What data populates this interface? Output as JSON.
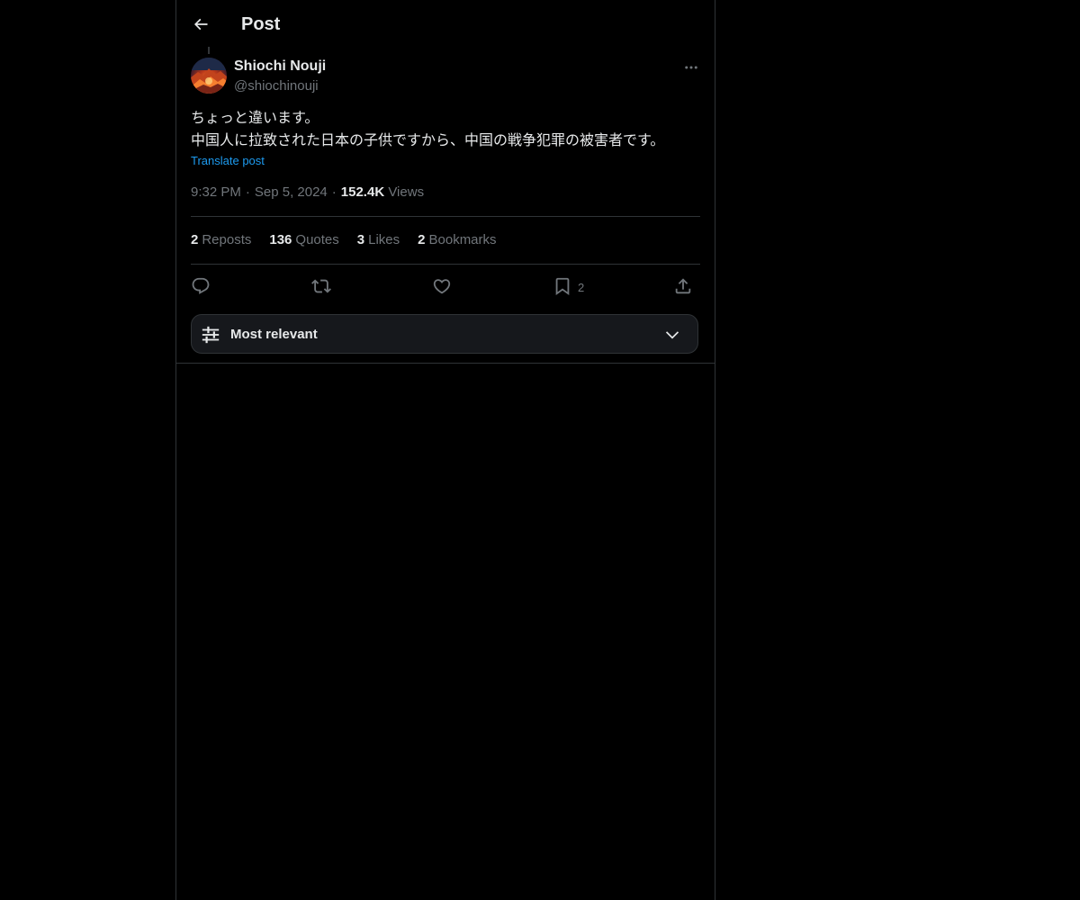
{
  "header": {
    "title": "Post",
    "back_icon": "arrow-left-icon"
  },
  "post": {
    "author": {
      "display_name": "Shiochi Nouji",
      "handle": "@shiochinouji"
    },
    "text_lines": [
      "ちょっと違います。",
      "中国人に拉致された日本の子供ですから、中国の戦争犯罪の被害者です。"
    ],
    "translate_label": "Translate post",
    "time": "9:32 PM",
    "date": "Sep 5, 2024",
    "views_count": "152.4K",
    "views_label": "Views",
    "separator": "·"
  },
  "stats": [
    {
      "count": "2",
      "label": "Reposts"
    },
    {
      "count": "136",
      "label": "Quotes"
    },
    {
      "count": "3",
      "label": "Likes"
    },
    {
      "count": "2",
      "label": "Bookmarks"
    }
  ],
  "actions": {
    "reply_icon": "reply-icon",
    "repost_icon": "repost-icon",
    "like_icon": "heart-icon",
    "bookmark_icon": "bookmark-icon",
    "bookmark_count": "2",
    "share_icon": "share-icon"
  },
  "sort": {
    "label": "Most relevant",
    "icon": "sliders-icon",
    "chevron": "chevron-down-icon"
  },
  "colors": {
    "background": "#000000",
    "text_primary": "#e7e9ea",
    "text_secondary": "#71767b",
    "accent": "#1d9bf0",
    "border": "#2f3336"
  }
}
